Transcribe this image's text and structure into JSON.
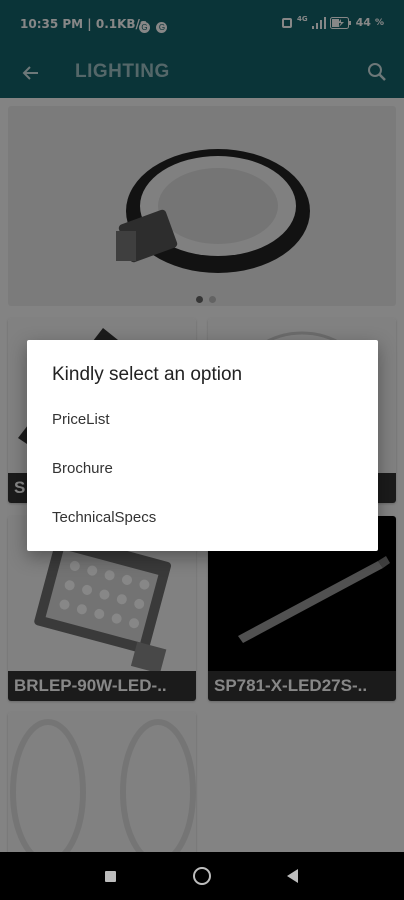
{
  "status_bar": {
    "time": "10:35 PM | 0.1KB/s",
    "badge1": "G",
    "badge2": "G",
    "network": "4G",
    "battery": "44"
  },
  "app_bar": {
    "title": "LIGHTING",
    "back_icon": "arrow-left-icon",
    "search_icon": "search-icon"
  },
  "banner": {
    "page_count": 2,
    "active_page": 1
  },
  "products": [
    {
      "label": "S"
    },
    {
      "label": ""
    },
    {
      "label": "BRLEP-90W-LED-.."
    },
    {
      "label": "SP781-X-LED27S-.."
    }
  ],
  "dialog": {
    "title": "Kindly select an option",
    "options": [
      "PriceList",
      "Brochure",
      "TechnicalSpecs"
    ]
  },
  "colors": {
    "primary": "#14626a",
    "label_bg": "#333333",
    "scrim": "rgba(0,0,0,0.47)"
  }
}
